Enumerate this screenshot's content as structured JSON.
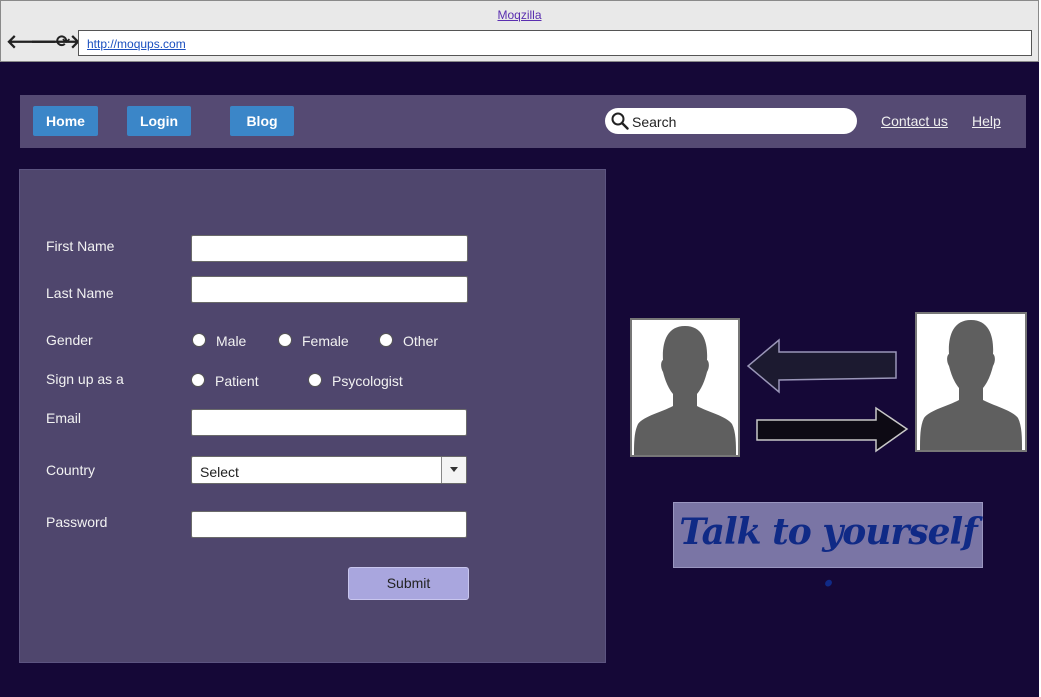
{
  "browser": {
    "window_title": "Moqzilla",
    "url": "http://moqups.com",
    "back_glyph": "🡐",
    "forward_glyph": "🡒",
    "reload_glyph": "⟳"
  },
  "nav": {
    "home_label": "Home",
    "login_label": "Login",
    "blog_label": "Blog",
    "search_placeholder": "Search",
    "contact_label": "Contact us",
    "help_label": "Help"
  },
  "form": {
    "first_name_label": "First Name",
    "last_name_label": "Last Name",
    "gender_label": "Gender",
    "gender_options": [
      "Male",
      "Female",
      "Other"
    ],
    "signup_label": "Sign up as a",
    "signup_options": [
      "Patient",
      "Psycologist"
    ],
    "email_label": "Email",
    "country_label": "Country",
    "country_value": "Select",
    "password_label": "Password",
    "submit_label": "Submit"
  },
  "illustration": {
    "slogan": "Talk to yourself ."
  },
  "colors": {
    "page_bg": "#150837",
    "nav_bg": "#554a73",
    "nav_button": "#3b86c8",
    "form_bg": "#4f466d",
    "submit_bg": "#a9a6de",
    "slogan_text": "#102a86"
  }
}
